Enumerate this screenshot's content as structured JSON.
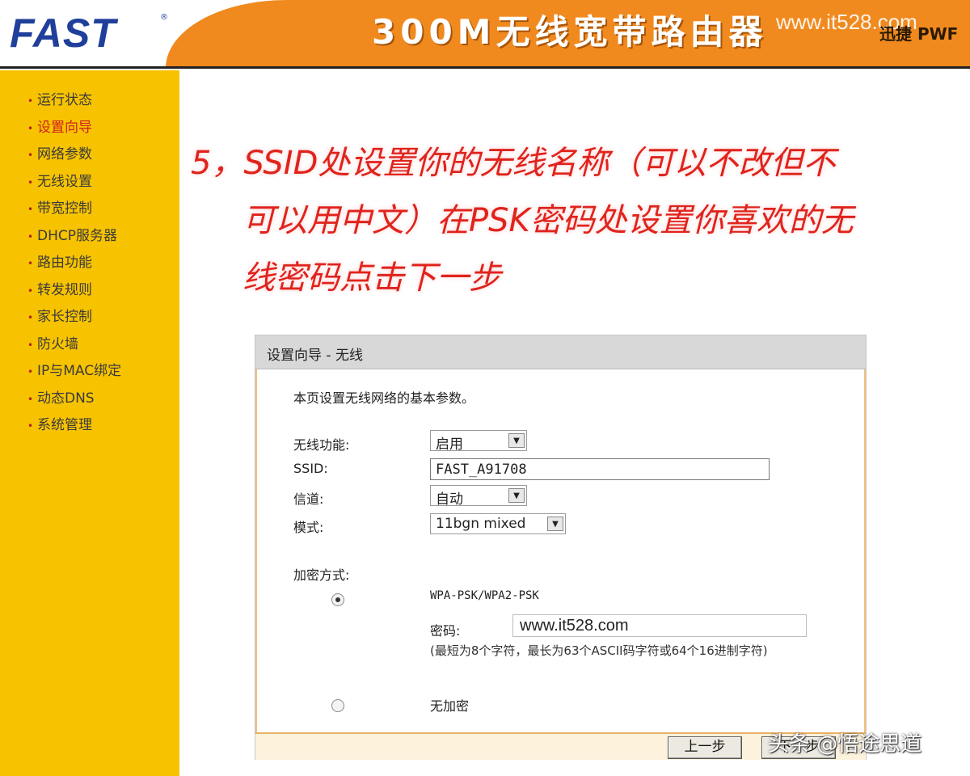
{
  "header": {
    "brand": "FAST",
    "brand_mark": "®",
    "product_title": "300M无线宽带路由器",
    "slogan": "迅捷 PWF",
    "watermark_url": "www.it528.com"
  },
  "sidebar": {
    "items": [
      {
        "label": "运行状态"
      },
      {
        "label": "设置向导"
      },
      {
        "label": "网络参数"
      },
      {
        "label": "无线设置"
      },
      {
        "label": "带宽控制"
      },
      {
        "label": "DHCP服务器"
      },
      {
        "label": "路由功能"
      },
      {
        "label": "转发规则"
      },
      {
        "label": "家长控制"
      },
      {
        "label": "防火墙"
      },
      {
        "label": "IP与MAC绑定"
      },
      {
        "label": "动态DNS"
      },
      {
        "label": "系统管理"
      }
    ],
    "active_index": 1
  },
  "instruction": {
    "line1": "5，SSID处设置你的无线名称（可以不改但不",
    "line2": "可以用中文）在PSK密码处设置你喜欢的无",
    "line3": "线密码点击下一步"
  },
  "wizard": {
    "title": "设置向导 - 无线",
    "description": "本页设置无线网络的基本参数。",
    "wireless_function_label": "无线功能:",
    "wireless_function_value": "启用",
    "ssid_label": "SSID:",
    "ssid_value": "FAST_A91708",
    "channel_label": "信道:",
    "channel_value": "自动",
    "mode_label": "模式:",
    "mode_value": "11bgn mixed",
    "encryption_label": "加密方式:",
    "wpa_option_label": "WPA-PSK/WPA2-PSK",
    "password_label": "密码:",
    "password_value": "www.it528.com",
    "password_hint": "(最短为8个字符，最长为63个ASCII码字符或64个16进制字符)",
    "no_encryption_label": "无加密",
    "prev_button": "上一步",
    "next_button": "下一步"
  },
  "watermark": {
    "toutiao": "头条 @悟途思道"
  },
  "colors": {
    "brand_blue": "#1f3f9a",
    "header_orange": "#f08a1e",
    "sidebar_yellow": "#f7c300",
    "instruction_red": "#e0231c",
    "active_nav": "#d02020"
  }
}
